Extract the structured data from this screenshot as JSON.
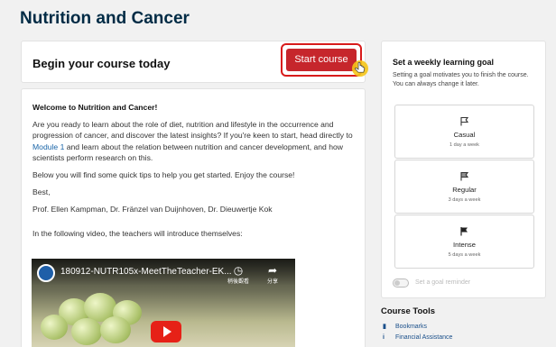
{
  "page": {
    "title": "Nutrition and Cancer"
  },
  "begin": {
    "title": "Begin your course today",
    "start_button": "Start course"
  },
  "welcome": {
    "heading": "Welcome to Nutrition and Cancer!",
    "p1_before": "Are you ready to learn about the role of diet, nutrition and lifestyle in the occurrence and progression of cancer, and discover the latest insights? If you're keen to start, head directly to ",
    "p1_link": "Module 1",
    "p1_after": " and learn about the relation between nutrition and cancer development, and how scientists perform research on this.",
    "p2": "Below you will find some quick tips to help you get started. Enjoy the course!",
    "p3": "Best,",
    "p4": "Prof. Ellen Kampman, Dr. Fränzel van Duijnhoven, Dr. Dieuwertje Kok",
    "p5": "In the following video, the teachers will introduce themselves:"
  },
  "video": {
    "title": "180912-NUTR105x-MeetTheTeacher-EK...",
    "watch_later_label": "稍後觀看",
    "share_label": "分享"
  },
  "goal": {
    "title": "Set a weekly learning goal",
    "description": "Setting a goal motivates you to finish the course. You can always change it later.",
    "options": [
      {
        "label": "Casual",
        "sub": "1 day a week"
      },
      {
        "label": "Regular",
        "sub": "3 days a week"
      },
      {
        "label": "Intense",
        "sub": "5 days a week"
      }
    ],
    "reminder_label": "Set a goal reminder"
  },
  "tools": {
    "title": "Course Tools",
    "items": [
      {
        "label": "Bookmarks",
        "icon": "bookmark-icon"
      },
      {
        "label": "Financial Assistance",
        "icon": "info-icon"
      }
    ]
  },
  "colors": {
    "accent_red": "#c6262c",
    "link_blue": "#1a65a8",
    "title_navy": "#002b45"
  }
}
